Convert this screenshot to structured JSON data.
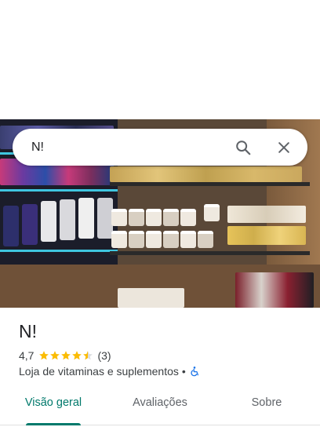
{
  "search": {
    "query": "N!"
  },
  "place": {
    "name": "N!",
    "rating": "4,7",
    "stars": 4.5,
    "review_count": "(3)",
    "category": "Loja de vitaminas e suplementos",
    "separator": "•"
  },
  "tabs": [
    {
      "label": "Visão geral",
      "active": true
    },
    {
      "label": "Avaliações",
      "active": false
    },
    {
      "label": "Sobre",
      "active": false
    }
  ],
  "colors": {
    "accent": "#00796b",
    "star": "#fbbc04",
    "accessibility": "#1a73e8"
  },
  "icons": [
    "search-icon",
    "close-icon",
    "star-icon",
    "wheelchair-icon"
  ]
}
